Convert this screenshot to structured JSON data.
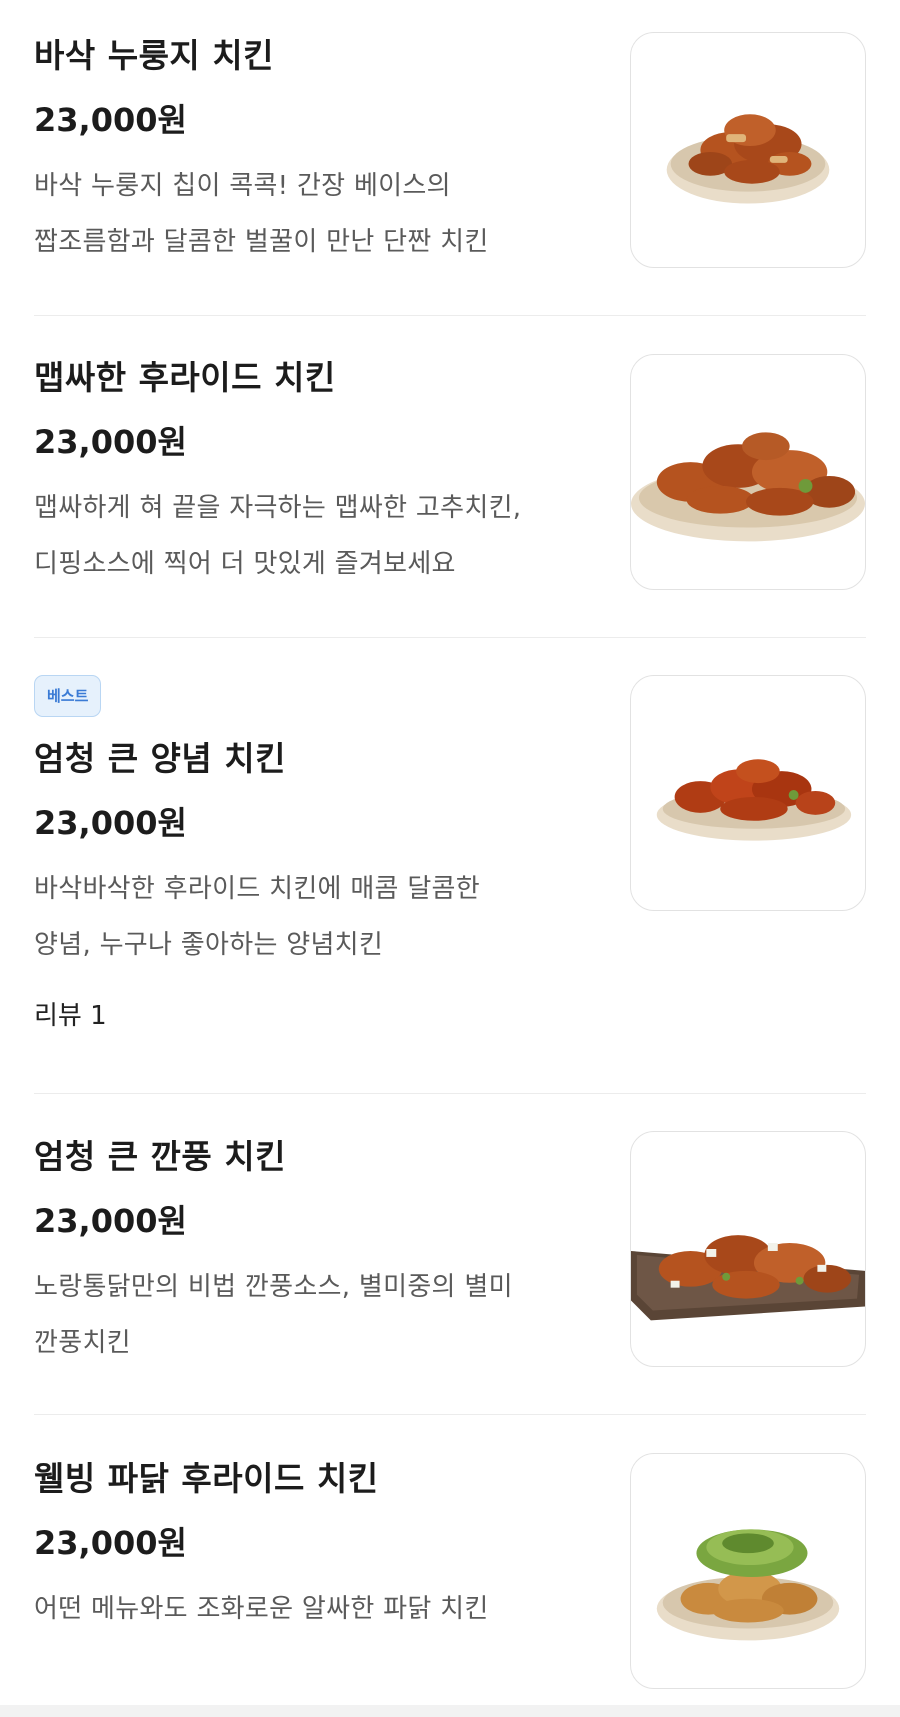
{
  "menu": {
    "items": [
      {
        "name": "바삭 누룽지 치킨",
        "price": "23,000원",
        "description_lines": [
          "바삭 누룽지 칩이 콕콕! 간장 베이스의",
          "짭조름함과 달콤한 벌꿀이 만난 단짠 치킨"
        ],
        "badge": "",
        "review": "",
        "image_icon": "chicken-plate-image"
      },
      {
        "name": "맵싸한 후라이드 치킨",
        "price": "23,000원",
        "description_lines": [
          "맵싸하게 혀 끝을 자극하는 맵싸한 고추치킨,",
          "디핑소스에 찍어 더 맛있게 즐겨보세요"
        ],
        "badge": "",
        "review": "",
        "image_icon": "chicken-plate-image"
      },
      {
        "name": "엄청 큰 양념 치킨",
        "price": "23,000원",
        "description_lines": [
          "바삭바삭한 후라이드 치킨에 매콤 달콤한",
          "양념, 누구나 좋아하는 양념치킨"
        ],
        "badge": "베스트",
        "review": "리뷰 1",
        "image_icon": "chicken-plate-image"
      },
      {
        "name": "엄청 큰 깐풍 치킨",
        "price": "23,000원",
        "description_lines": [
          "노랑통닭만의 비법 깐풍소스, 별미중의 별미",
          "깐풍치킨"
        ],
        "badge": "",
        "review": "",
        "image_icon": "chicken-plate-image"
      },
      {
        "name": "웰빙 파닭 후라이드 치킨",
        "price": "23,000원",
        "description_lines": [
          "어떤 메뉴와도 조화로운 알싸한 파닭 치킨"
        ],
        "badge": "",
        "review": "",
        "image_icon": "chicken-plate-image"
      }
    ]
  },
  "colors": {
    "badge_text": "#3a7bd5",
    "badge_bg": "#e6f1fc",
    "chicken": "#b5531f",
    "plate": "#e9ddc9",
    "scallion": "#6f9a3a"
  }
}
